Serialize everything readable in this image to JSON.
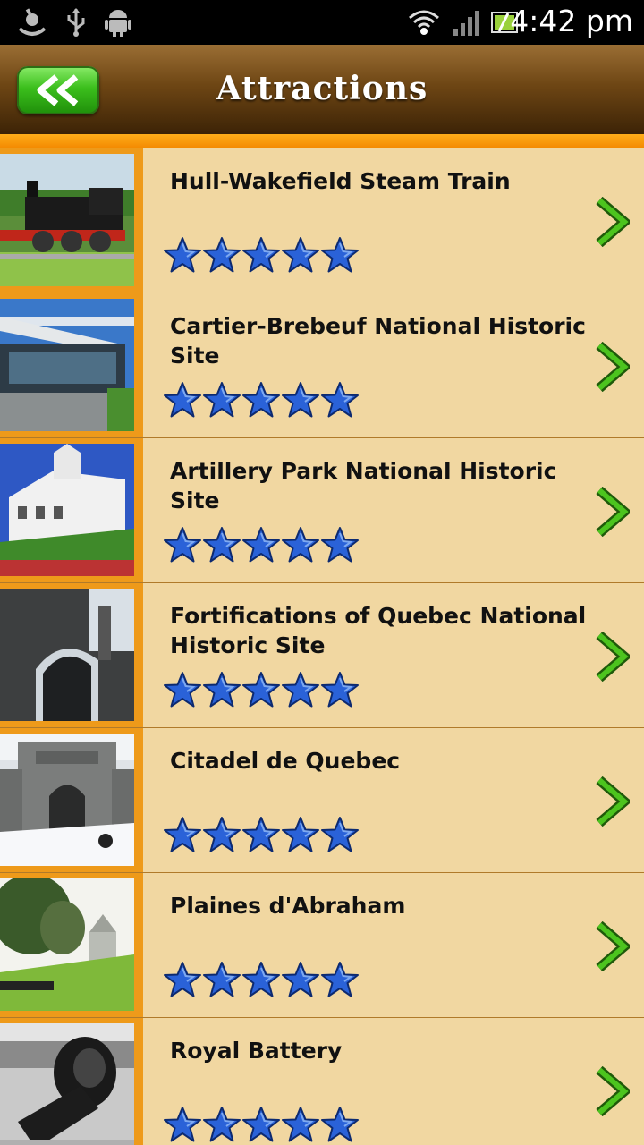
{
  "status_bar": {
    "time": "4:42 pm",
    "icons": [
      "debug-icon",
      "usb-icon",
      "android-icon",
      "wifi-icon",
      "signal-icon",
      "battery-icon"
    ]
  },
  "header": {
    "title": "Attractions",
    "back_icon": "double-chevron-left-icon",
    "colors": {
      "bar": "#6e4614",
      "stripe": "#f38800",
      "back_button": "#3bbf1c"
    }
  },
  "list": {
    "items": [
      {
        "title": "Hull-Wakefield Steam Train",
        "rating": 5,
        "thumb": "steam-train-photo"
      },
      {
        "title": "Cartier-Brebeuf National Historic Site",
        "rating": 5,
        "thumb": "museum-building-photo"
      },
      {
        "title": "Artillery Park National Historic Site",
        "rating": 5,
        "thumb": "white-buildings-photo"
      },
      {
        "title": "Fortifications of Quebec National Historic Site",
        "rating": 5,
        "thumb": "stone-arch-photo"
      },
      {
        "title": "Citadel de Quebec",
        "rating": 5,
        "thumb": "citadel-gate-photo"
      },
      {
        "title": "Plaines d'Abraham",
        "rating": 5,
        "thumb": "park-photo"
      },
      {
        "title": "Royal Battery",
        "rating": 5,
        "thumb": "cannon-photo"
      }
    ],
    "star_color": "#2a62d8",
    "chevron_color": "#3aae16"
  }
}
